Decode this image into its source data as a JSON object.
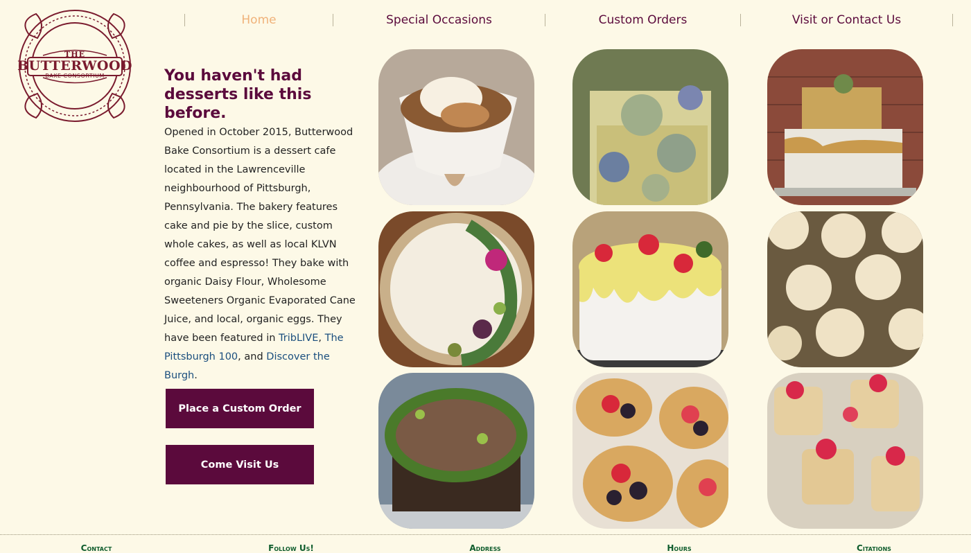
{
  "logo": {
    "the": "THE",
    "name": "BUTTERWOOD",
    "sub": "BAKE CONSORTIUM",
    "color": "#7a1b2e"
  },
  "nav": {
    "items": [
      {
        "label": "Home",
        "active": true
      },
      {
        "label": "Special Occasions",
        "active": false
      },
      {
        "label": "Custom Orders",
        "active": false
      },
      {
        "label": "Visit or Contact Us",
        "active": false
      }
    ]
  },
  "intro": {
    "headline": "You haven't had desserts like this before.",
    "text_before": "Opened in October 2015, Butterwood Bake Consortium is a dessert cafe located in the Lawrenceville neighbourhood of Pittsburgh, Pennsylvania. The bakery features cake and pie by the slice, custom whole cakes, as well as local KLVN coffee and espresso! They bake with organic Daisy Flour, Wholesome Sweeteners Organic Evaporated Cane Juice, and local, organic eggs. They have been featured in ",
    "link1": "TribLIVE",
    "sep1": ", ",
    "link2": "The Pittsburgh 100",
    "sep2": ", and ",
    "link3": "Discover the Burgh",
    "end": "."
  },
  "buttons": {
    "order": "Place a Custom Order",
    "visit": "Come Visit Us"
  },
  "gallery": [
    {
      "name": "affogato-photo",
      "icon": "dessert-cup-photo"
    },
    {
      "name": "succulent-cake-photo",
      "icon": "cake-photo"
    },
    {
      "name": "gold-leaf-cake-photo",
      "icon": "cake-photo"
    },
    {
      "name": "floral-pie-photo",
      "icon": "pie-photo"
    },
    {
      "name": "strawberry-drip-cake-photo",
      "icon": "cake-photo"
    },
    {
      "name": "rose-cupcakes-photo",
      "icon": "cupcake-photo"
    },
    {
      "name": "chocolate-wreath-cake-photo",
      "icon": "cake-photo"
    },
    {
      "name": "berry-tarts-photo",
      "icon": "tart-photo"
    },
    {
      "name": "petal-mini-cakes-photo",
      "icon": "cake-photo"
    }
  ],
  "footer": {
    "headings": [
      "Contact",
      "Follow Us!",
      "Address",
      "Hours",
      "Citations"
    ]
  },
  "colors": {
    "background": "#fdf9e7",
    "accent": "#5b0a3c",
    "nav_active": "#f0b27a",
    "link": "#1a4e7e",
    "footer_heading": "#0e5c2c"
  }
}
